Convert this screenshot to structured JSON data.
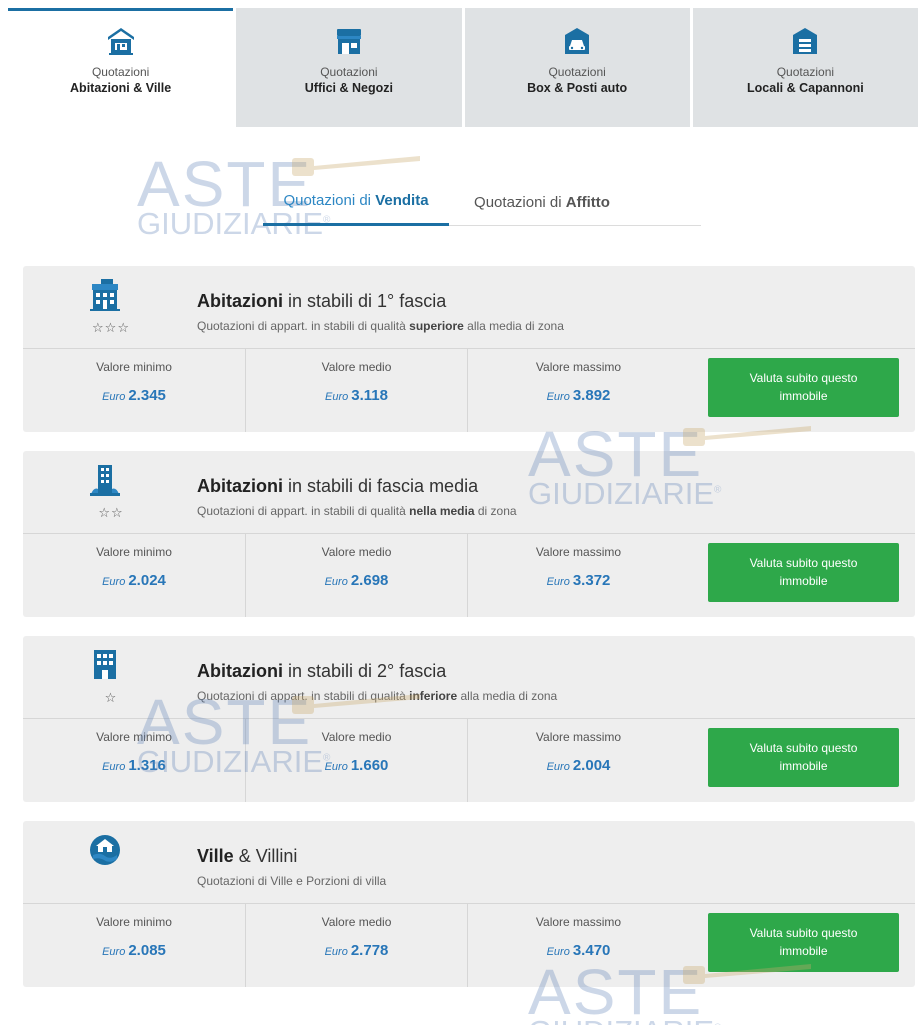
{
  "category_tabs": [
    {
      "sub": "Quotazioni",
      "name": "Abitazioni & Ville",
      "icon": "house-icon",
      "active": true
    },
    {
      "sub": "Quotazioni",
      "name": "Uffici & Negozi",
      "icon": "shop-icon",
      "active": false
    },
    {
      "sub": "Quotazioni",
      "name": "Box & Posti auto",
      "icon": "garage-icon",
      "active": false
    },
    {
      "sub": "Quotazioni",
      "name": "Locali & Capannoni",
      "icon": "warehouse-icon",
      "active": false
    }
  ],
  "mode_tabs": [
    {
      "prefix": "Quotazioni di ",
      "strong": "Vendita",
      "active": true
    },
    {
      "prefix": "Quotazioni di ",
      "strong": "Affitto",
      "active": false
    }
  ],
  "watermark": {
    "line1": "ASTE",
    "line2": "GIUDIZIARIE",
    "mark": "®"
  },
  "labels": {
    "min": "Valore minimo",
    "mid": "Valore medio",
    "max": "Valore massimo",
    "currency": "Euro",
    "cta": "Valuta subito questo immobile"
  },
  "colors": {
    "primary": "#1b6fa3",
    "price": "#2876b8",
    "cta": "#2ea84a",
    "tab_inactive": "#dfe2e4",
    "card_bg": "#eeeeee"
  },
  "cards": [
    {
      "icon": "building-first-tier-icon",
      "stars": "☆☆☆",
      "title_strong": "Abitazioni",
      "title_rest": " in stabili di 1° fascia",
      "desc_pre": "Quotazioni di appart. in stabili di qualità ",
      "desc_strong": "superiore",
      "desc_post": " alla media di zona",
      "min": "2.345",
      "mid": "3.118",
      "max": "3.892"
    },
    {
      "icon": "building-mid-tier-icon",
      "stars": "☆☆",
      "title_strong": "Abitazioni",
      "title_rest": " in stabili di fascia media",
      "desc_pre": "Quotazioni di appart. in stabili di qualità ",
      "desc_strong": "nella media",
      "desc_post": " di zona",
      "min": "2.024",
      "mid": "2.698",
      "max": "3.372"
    },
    {
      "icon": "building-second-tier-icon",
      "stars": "☆",
      "title_strong": "Abitazioni",
      "title_rest": " in stabili di 2° fascia",
      "desc_pre": "Quotazioni di appart. in stabili di qualità ",
      "desc_strong": "inferiore",
      "desc_post": " alla media di zona",
      "min": "1.316",
      "mid": "1.660",
      "max": "2.004"
    },
    {
      "icon": "villa-hand-icon",
      "stars": "",
      "title_strong": "Ville",
      "title_rest": " & Villini",
      "desc_pre": "Quotazioni di Ville e Porzioni di villa",
      "desc_strong": "",
      "desc_post": "",
      "min": "2.085",
      "mid": "2.778",
      "max": "3.470"
    }
  ]
}
